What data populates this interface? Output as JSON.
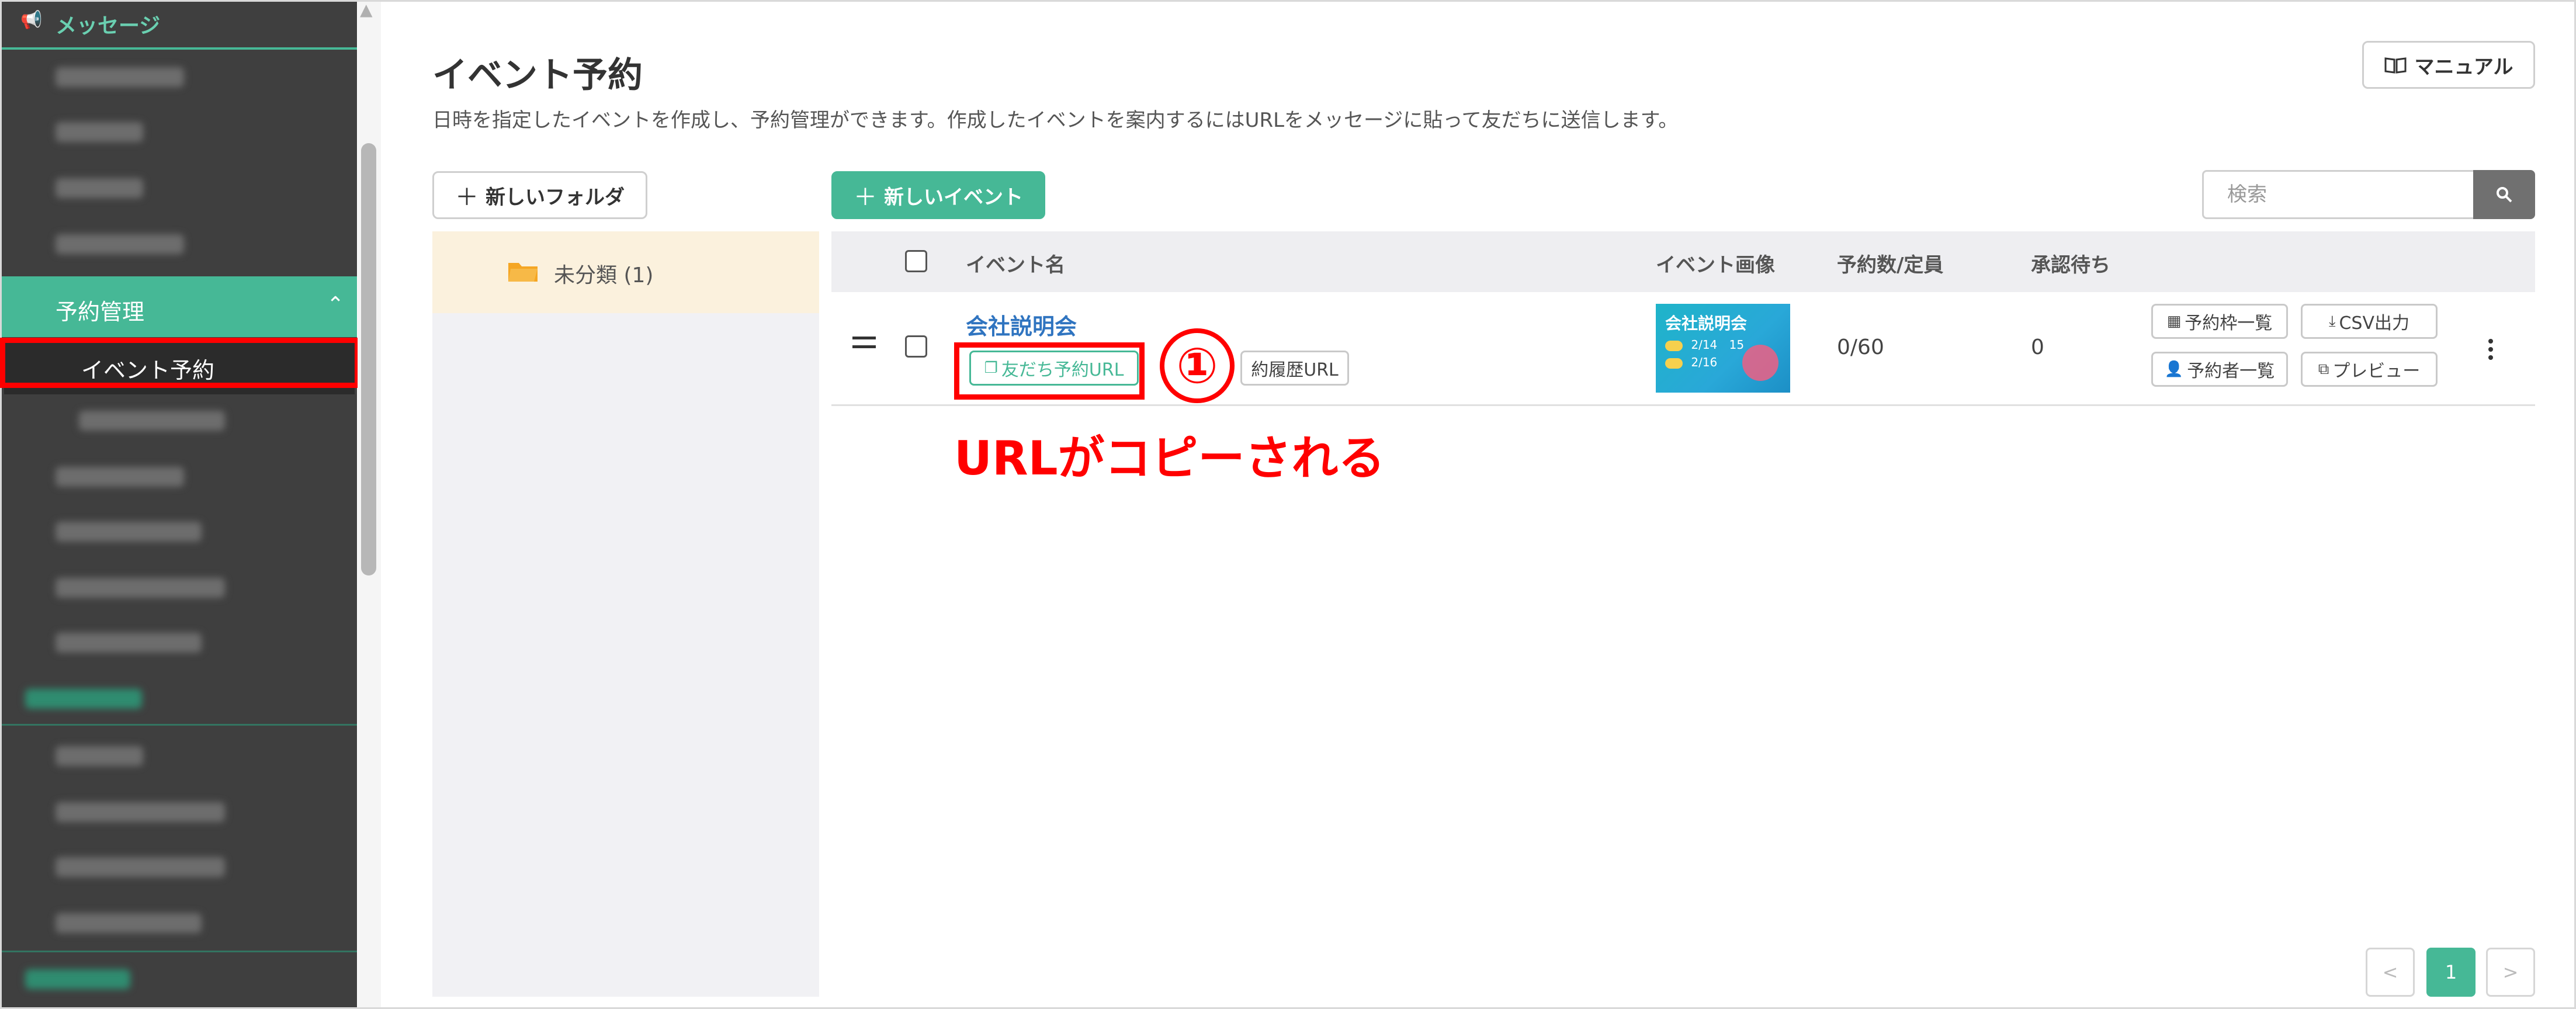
{
  "sidebar": {
    "header_label": "メッセージ",
    "parent_item": "予約管理",
    "active_item": "イベント予約"
  },
  "page": {
    "title": "イベント予約",
    "description": "日時を指定したイベントを作成し、予約管理ができます。作成したイベントを案内するにはURLをメッセージに貼って友だちに送信します。",
    "manual_button": "マニュアル"
  },
  "toolbar": {
    "new_folder": "新しいフォルダ",
    "new_event": "新しいイベント",
    "search_placeholder": "検索"
  },
  "folders": [
    {
      "label": "未分類 (1)"
    }
  ],
  "table": {
    "headers": {
      "event_name": "イベント名",
      "event_image": "イベント画像",
      "reservations": "予約数/定員",
      "pending": "承認待ち"
    },
    "rows": [
      {
        "name": "会社説明会",
        "friend_url_button": "友だち予約URL",
        "history_url_button": "約履歴URL",
        "image_title": "会社説明会",
        "image_date1": "2/14",
        "image_date1_extra": "15",
        "image_date2": "2/16",
        "reservations": "0/60",
        "pending": "0",
        "actions": {
          "slots": "予約枠一覧",
          "csv": "CSV出力",
          "reservers": "予約者一覧",
          "preview": "プレビュー"
        }
      }
    ]
  },
  "annotation": {
    "number": "①",
    "caption": "URLがコピーされる"
  },
  "pagination": {
    "prev": "<",
    "current": "1",
    "next": ">"
  },
  "colors": {
    "accent": "#46b896",
    "annotation": "#ff0000",
    "link": "#2f74c0"
  }
}
